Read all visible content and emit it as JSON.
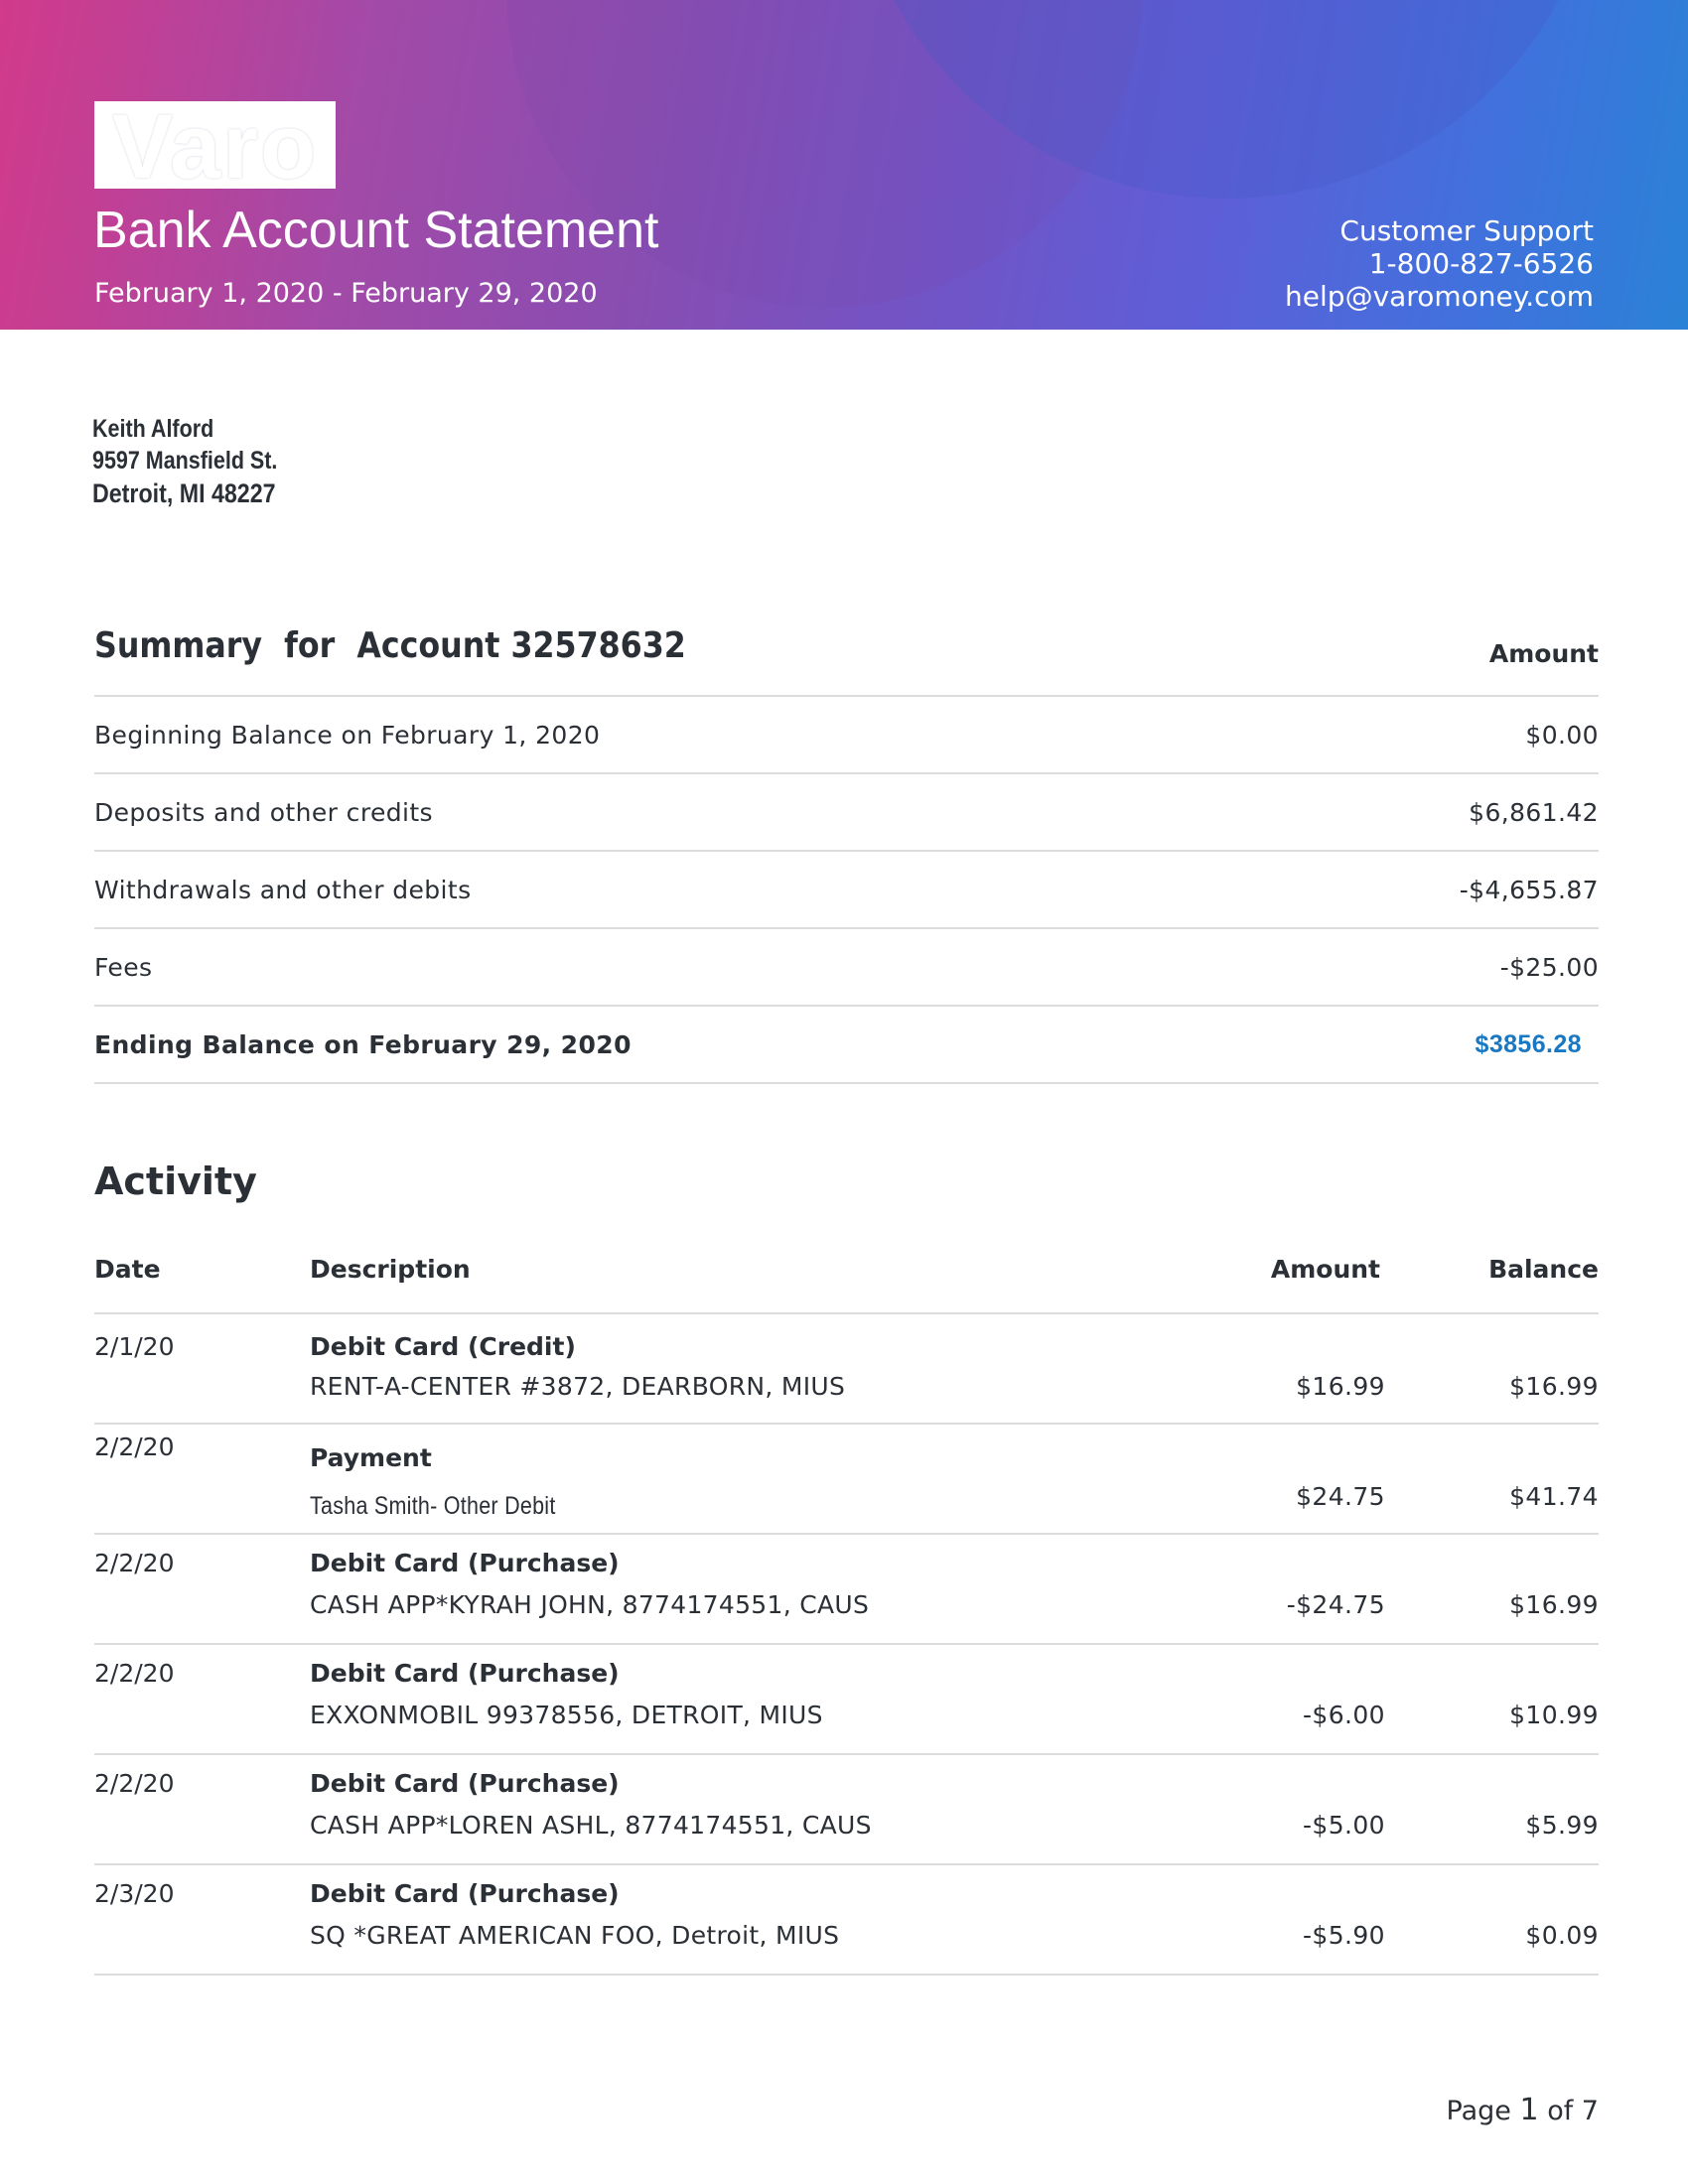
{
  "header": {
    "brand": "Varo",
    "title": "Bank Account Statement",
    "period": "February 1, 2020 - February 29, 2020",
    "support": {
      "label": "Customer Support",
      "phone": "1-800-827-6526",
      "email": "help@varomoney.com"
    },
    "colors": {
      "gradient_start": "#d23a8a",
      "gradient_mid": "#6f55c8",
      "gradient_end": "#2a82d6"
    }
  },
  "customer": {
    "name": "Keith Alford",
    "street": "9597 Mansfield St.",
    "city": "Detroit, MI 48227"
  },
  "summary": {
    "title_prefix": "Summary  for  Account",
    "account_number": "32578632",
    "amount_header": "Amount",
    "rows": [
      {
        "label": "Beginning Balance on February 1, 2020",
        "value": "$0.00"
      },
      {
        "label": "Deposits and other credits",
        "value": "$6,861.42"
      },
      {
        "label": "Withdrawals and other debits",
        "value": "-$4,655.87"
      },
      {
        "label": "Fees",
        "value": "-$25.00"
      }
    ],
    "ending": {
      "label": "Ending Balance on February 29, 2020",
      "value": "$3856.28",
      "color": "#1a78c2"
    }
  },
  "activity": {
    "title": "Activity",
    "columns": {
      "date": "Date",
      "description": "Description",
      "amount": "Amount",
      "balance": "Balance"
    },
    "rows": [
      {
        "date": "2/1/20",
        "type": "Debit Card (Credit)",
        "description": "RENT-A-CENTER #3872, DEARBORN, MIUS",
        "amount": "$16.99",
        "balance": "$16.99"
      },
      {
        "date": "2/2/20",
        "type": "Payment",
        "description": "Tasha Smith- Other Debit",
        "amount": "$24.75",
        "balance": "$41.74"
      },
      {
        "date": "2/2/20",
        "type": "Debit Card (Purchase)",
        "description": "CASH APP*KYRAH JOHN, 8774174551, CAUS",
        "amount": "-$24.75",
        "balance": "$16.99"
      },
      {
        "date": "2/2/20",
        "type": "Debit Card (Purchase)",
        "description": "EXXONMOBIL 99378556, DETROIT, MIUS",
        "amount": "-$6.00",
        "balance": "$10.99"
      },
      {
        "date": "2/2/20",
        "type": "Debit Card (Purchase)",
        "description": "CASH APP*LOREN ASHL, 8774174551, CAUS",
        "amount": "-$5.00",
        "balance": "$5.99"
      },
      {
        "date": "2/3/20",
        "type": "Debit Card (Purchase)",
        "description": "SQ *GREAT AMERICAN FOO, Detroit, MIUS",
        "amount": "-$5.90",
        "balance": "$0.09"
      }
    ]
  },
  "footer": {
    "page_prefix": "Page",
    "page_current": "1",
    "page_of": "of 7"
  }
}
